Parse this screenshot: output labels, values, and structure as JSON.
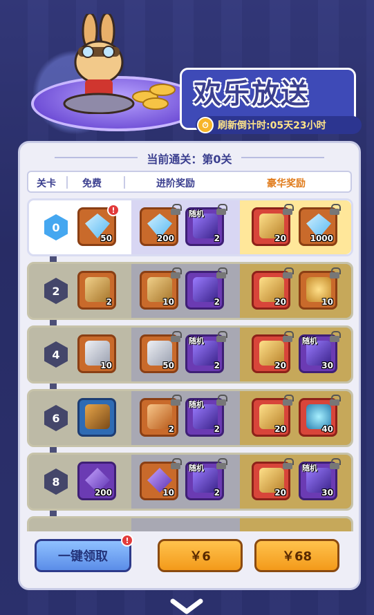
{
  "header": {
    "title": "欢乐放送",
    "timer_label": "刷新倒计时:",
    "timer_value": "05天23小时"
  },
  "progress": {
    "text": "当前通关：第0关"
  },
  "columns": {
    "stage": "关卡",
    "free": "免费",
    "advanced": "进阶奖励",
    "luxury": "豪华奖励"
  },
  "rows": [
    {
      "stage": "0",
      "free": {
        "icon": "diamond-icon",
        "count": "50",
        "alert": "!"
      },
      "advanced": [
        {
          "icon": "diamond-icon",
          "count": "200"
        },
        {
          "icon": "gift-box-icon",
          "tag": "随机",
          "count": "2"
        }
      ],
      "luxury": [
        {
          "icon": "golden-helmet-icon",
          "count": "20"
        },
        {
          "icon": "diamond-icon",
          "count": "1000"
        }
      ]
    },
    {
      "stage": "2",
      "free": {
        "icon": "scroll-icon",
        "count": "2"
      },
      "advanced": [
        {
          "icon": "scroll-icon",
          "count": "10"
        },
        {
          "icon": "gift-box-icon",
          "count": "2"
        }
      ],
      "luxury": [
        {
          "icon": "golden-helmet-icon",
          "count": "20"
        },
        {
          "icon": "gold-coin-icon",
          "count": "10"
        }
      ]
    },
    {
      "stage": "4",
      "free": {
        "icon": "paint-can-icon",
        "count": "10"
      },
      "advanced": [
        {
          "icon": "paint-can-icon",
          "count": "50"
        },
        {
          "icon": "gift-box-icon",
          "tag": "随机",
          "count": "2"
        }
      ],
      "luxury": [
        {
          "icon": "golden-helmet-icon",
          "count": "20"
        },
        {
          "icon": "gift-box-icon",
          "tag": "随机",
          "count": "30"
        }
      ]
    },
    {
      "stage": "6",
      "free": {
        "icon": "treasure-chest-icon",
        "count": ""
      },
      "advanced": [
        {
          "icon": "ticket-icon",
          "count": "2"
        },
        {
          "icon": "gift-box-icon",
          "tag": "随机",
          "count": "2"
        }
      ],
      "luxury": [
        {
          "icon": "golden-helmet-icon",
          "count": "20"
        },
        {
          "icon": "orb-icon",
          "count": "40"
        }
      ]
    },
    {
      "stage": "8",
      "free": {
        "icon": "crystal-icon",
        "count": "200"
      },
      "advanced": [
        {
          "icon": "crystal-icon",
          "count": "10"
        },
        {
          "icon": "gift-box-icon",
          "tag": "随机",
          "count": "2"
        }
      ],
      "luxury": [
        {
          "icon": "golden-helmet-icon",
          "count": "20"
        },
        {
          "icon": "gift-box-icon",
          "tag": "随机",
          "count": "30"
        }
      ]
    }
  ],
  "buttons": {
    "claim_all": "一键领取",
    "claim_alert": "!",
    "buy_advanced": "￥6",
    "buy_luxury": "￥68"
  },
  "colors": {
    "accent": "#3b3f8f",
    "luxury": "#e07b1b",
    "button_orange": "#f39a1a"
  }
}
